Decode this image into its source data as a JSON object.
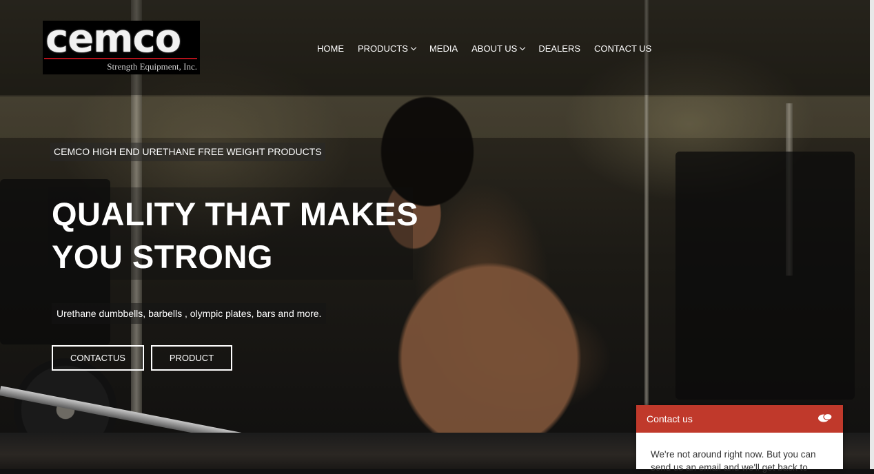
{
  "header": {
    "logo_word": "cemco",
    "logo_sub": "Strength Equipment, Inc.",
    "nav": [
      {
        "label": "HOME",
        "dropdown": false
      },
      {
        "label": "PRODUCTS",
        "dropdown": true
      },
      {
        "label": "MEDIA",
        "dropdown": false
      },
      {
        "label": "ABOUT US",
        "dropdown": true
      },
      {
        "label": "DEALERS",
        "dropdown": false
      },
      {
        "label": "CONTACT US",
        "dropdown": false
      }
    ]
  },
  "hero": {
    "eyebrow": "CEMCO HIGH END URETHANE FREE WEIGHT PRODUCTS",
    "headline_line1": "QUALITY THAT MAKES",
    "headline_line2": "YOU STRONG",
    "subline": "Urethane dumbbells, barbells , olympic plates, bars and more.",
    "buttons": {
      "contact": "CONTACTUS",
      "product": "PRODUCT"
    }
  },
  "widget": {
    "title": "Contact us",
    "icon": "chat-bubbles-icon",
    "message": "We're not around right now. But you can send us an email and we'll get back to"
  },
  "colors": {
    "accent": "#c0392b",
    "logo_line": "#b5121b"
  }
}
